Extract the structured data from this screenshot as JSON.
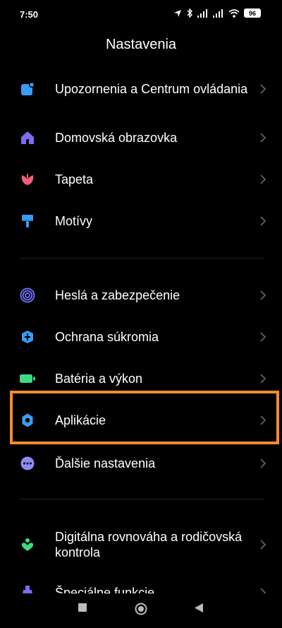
{
  "status": {
    "time": "7:50",
    "battery": "96"
  },
  "header": {
    "title": "Nastavenia"
  },
  "items": [
    {
      "label": "Upozornenia a Centrum ovládania",
      "icon": "notification-icon",
      "color": "#3a9cf5"
    },
    {
      "label": "Domovská obrazovka",
      "icon": "home-icon",
      "color": "#7b6cf0"
    },
    {
      "label": "Tapeta",
      "icon": "wallpaper-flower-icon",
      "color": "#f0607a"
    },
    {
      "label": "Motívy",
      "icon": "themes-brush-icon",
      "color": "#3a9cf5"
    },
    {
      "label": "Heslá a zabezpečenie",
      "icon": "fingerprint-icon",
      "color": "#6b6cf0"
    },
    {
      "label": "Ochrana súkromia",
      "icon": "privacy-shield-icon",
      "color": "#3a9cf5"
    },
    {
      "label": "Batéria a výkon",
      "icon": "battery-icon",
      "color": "#3ddc84"
    },
    {
      "label": "Aplikácie",
      "icon": "apps-gear-icon",
      "color": "#3a9cf5"
    },
    {
      "label": "Ďalšie nastavenia",
      "icon": "more-settings-icon",
      "color": "#8b8cf5"
    },
    {
      "label": "Digitálna rovnováha a rodičovská kontrola",
      "icon": "digital-wellbeing-icon",
      "color": "#3ddc84"
    },
    {
      "label": "Špeciálne funkcie",
      "icon": "special-features-icon",
      "color": "#7b6cf0"
    }
  ],
  "accent": "#f98a2c"
}
